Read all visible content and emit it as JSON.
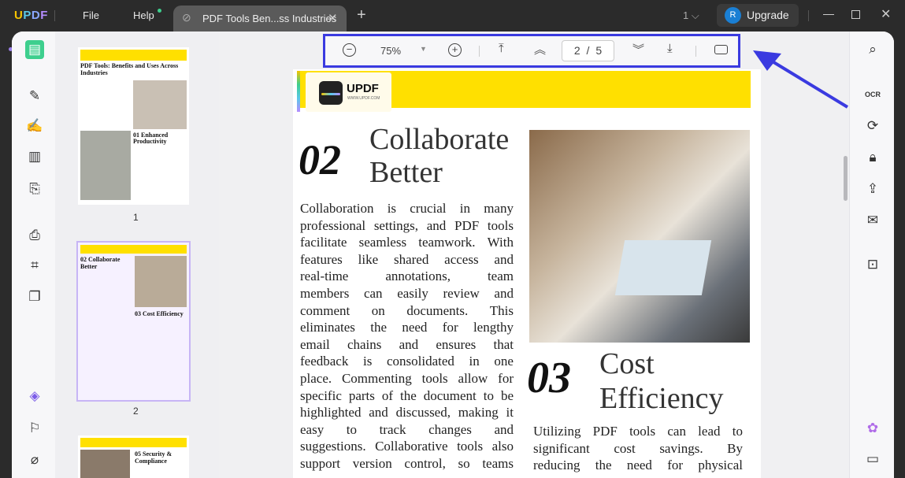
{
  "titlebar": {
    "logo": "UPDF",
    "menu": [
      "File",
      "Help"
    ],
    "tab_title": "PDF Tools Ben...ss Industries",
    "new_tab": "+",
    "window_count": "1",
    "avatar_initial": "R",
    "upgrade": "Upgrade"
  },
  "toolbar": {
    "zoom": "75%",
    "current_page": "2",
    "separator": "/",
    "total_pages": "5"
  },
  "thumbnails": [
    {
      "label": "1",
      "title": "PDF Tools: Benefits and Uses Across Industries",
      "num": "01",
      "heading": "Enhanced Productivity"
    },
    {
      "label": "2",
      "num_a": "02",
      "heading_a": "Collaborate Better",
      "num_b": "03",
      "heading_b": "Cost Efficiency"
    },
    {
      "num": "05",
      "heading": "Security & Compliance"
    }
  ],
  "page": {
    "logo_text": "UPDF",
    "logo_url": "WWW.UPDF.COM",
    "section1": {
      "number": "02",
      "title": [
        "Collaborate",
        "Better"
      ],
      "lines": [
        "Collaboration is crucial in many",
        "professional settings, and PDF tools",
        "facilitate seamless teamwork. With",
        "features like shared access and",
        "real-time annotations, team",
        "members can easily review and",
        "comment on documents. This",
        "eliminates the need for lengthy",
        "email chains and ensures that",
        "feedback is consolidated in one",
        "place. Commenting tools allow for",
        "specific parts of the document to be",
        "highlighted and discussed, making it",
        "easy to track changes and",
        "suggestions. Collaborative tools also",
        "support version control, so teams"
      ]
    },
    "section2": {
      "number": "03",
      "title": [
        "Cost",
        "Efficiency"
      ],
      "lines": [
        "Utilizing PDF tools can lead to",
        "significant cost savings. By",
        "reducing the need for physical"
      ]
    }
  },
  "colors": {
    "highlight": "#3a3ae0",
    "accent_yellow": "#ffe000",
    "active_tool": "#3ecf8e"
  }
}
